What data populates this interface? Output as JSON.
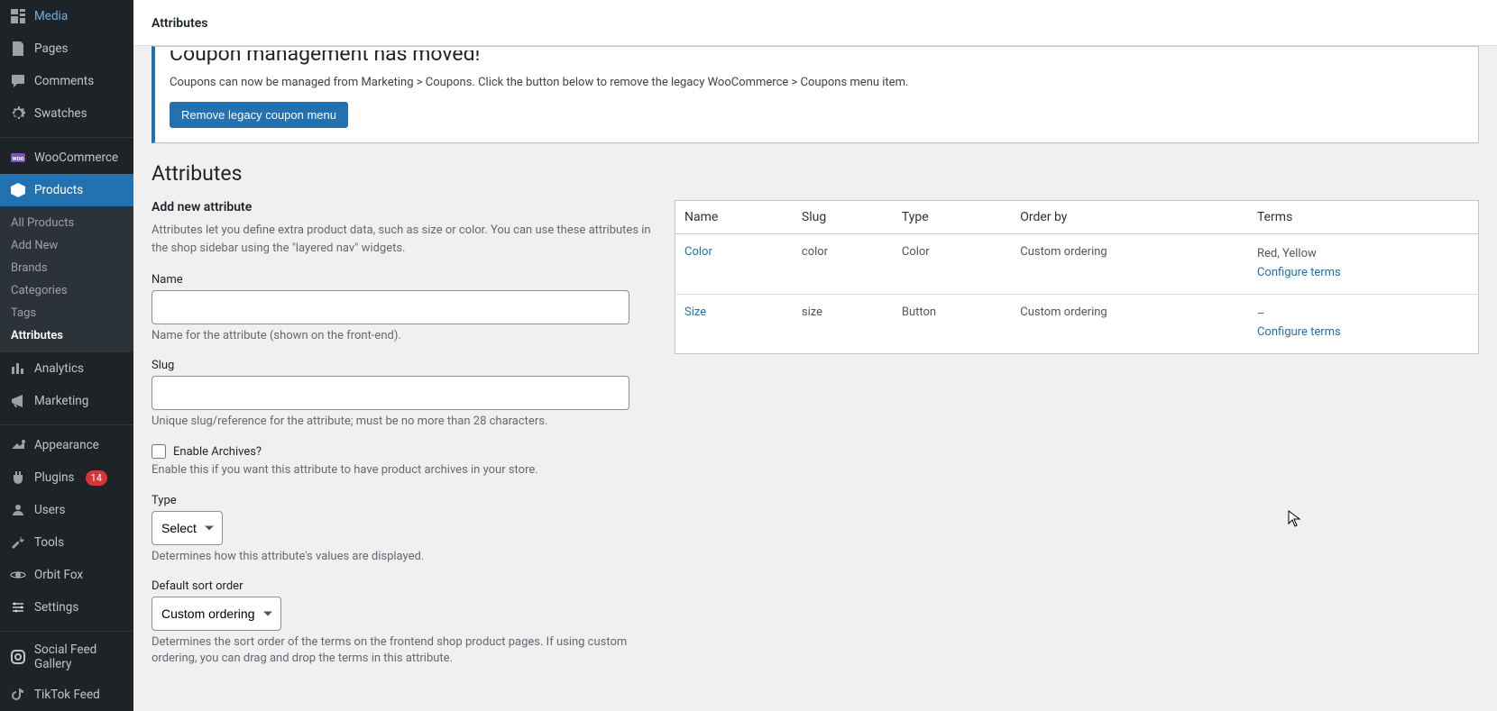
{
  "topbar": {
    "title": "Attributes"
  },
  "sidebar": {
    "items": [
      {
        "label": "Media",
        "icon": "media"
      },
      {
        "label": "Pages",
        "icon": "page"
      },
      {
        "label": "Comments",
        "icon": "comment"
      },
      {
        "label": "Swatches",
        "icon": "gear"
      },
      {
        "label": "WooCommerce",
        "icon": "woo"
      },
      {
        "label": "Products",
        "icon": "products",
        "active": true
      },
      {
        "label": "Analytics",
        "icon": "analytics"
      },
      {
        "label": "Marketing",
        "icon": "marketing"
      },
      {
        "label": "Appearance",
        "icon": "appearance"
      },
      {
        "label": "Plugins",
        "icon": "plugins",
        "badge": "14"
      },
      {
        "label": "Users",
        "icon": "users"
      },
      {
        "label": "Tools",
        "icon": "tools"
      },
      {
        "label": "Orbit Fox",
        "icon": "orbit"
      },
      {
        "label": "Settings",
        "icon": "settings"
      },
      {
        "label": "Social Feed Gallery",
        "icon": "social"
      },
      {
        "label": "TikTok Feed",
        "icon": "tiktok"
      }
    ],
    "submenu": [
      {
        "label": "All Products"
      },
      {
        "label": "Add New"
      },
      {
        "label": "Brands"
      },
      {
        "label": "Categories"
      },
      {
        "label": "Tags"
      },
      {
        "label": "Attributes",
        "current": true
      }
    ]
  },
  "notice": {
    "title": "Coupon management has moved!",
    "text": "Coupons can now be managed from Marketing > Coupons. Click the button below to remove the legacy WooCommerce > Coupons menu item.",
    "button": "Remove legacy coupon menu"
  },
  "page": {
    "heading": "Attributes"
  },
  "form": {
    "title": "Add new attribute",
    "desc": "Attributes let you define extra product data, such as size or color. You can use these attributes in the shop sidebar using the \"layered nav\" widgets.",
    "name_label": "Name",
    "name_help": "Name for the attribute (shown on the front-end).",
    "slug_label": "Slug",
    "slug_help": "Unique slug/reference for the attribute; must be no more than 28 characters.",
    "archives_label": "Enable Archives?",
    "archives_help": "Enable this if you want this attribute to have product archives in your store.",
    "type_label": "Type",
    "type_value": "Select",
    "type_help": "Determines how this attribute's values are displayed.",
    "sort_label": "Default sort order",
    "sort_value": "Custom ordering",
    "sort_help": "Determines the sort order of the terms on the frontend shop product pages. If using custom ordering, you can drag and drop the terms in this attribute."
  },
  "table": {
    "headers": {
      "name": "Name",
      "slug": "Slug",
      "type": "Type",
      "order_by": "Order by",
      "terms": "Terms"
    },
    "rows": [
      {
        "name": "Color",
        "slug": "color",
        "type": "Color",
        "order_by": "Custom ordering",
        "terms": "Red, Yellow",
        "configure": "Configure terms"
      },
      {
        "name": "Size",
        "slug": "size",
        "type": "Button",
        "order_by": "Custom ordering",
        "terms": "–",
        "configure": "Configure terms"
      }
    ]
  }
}
